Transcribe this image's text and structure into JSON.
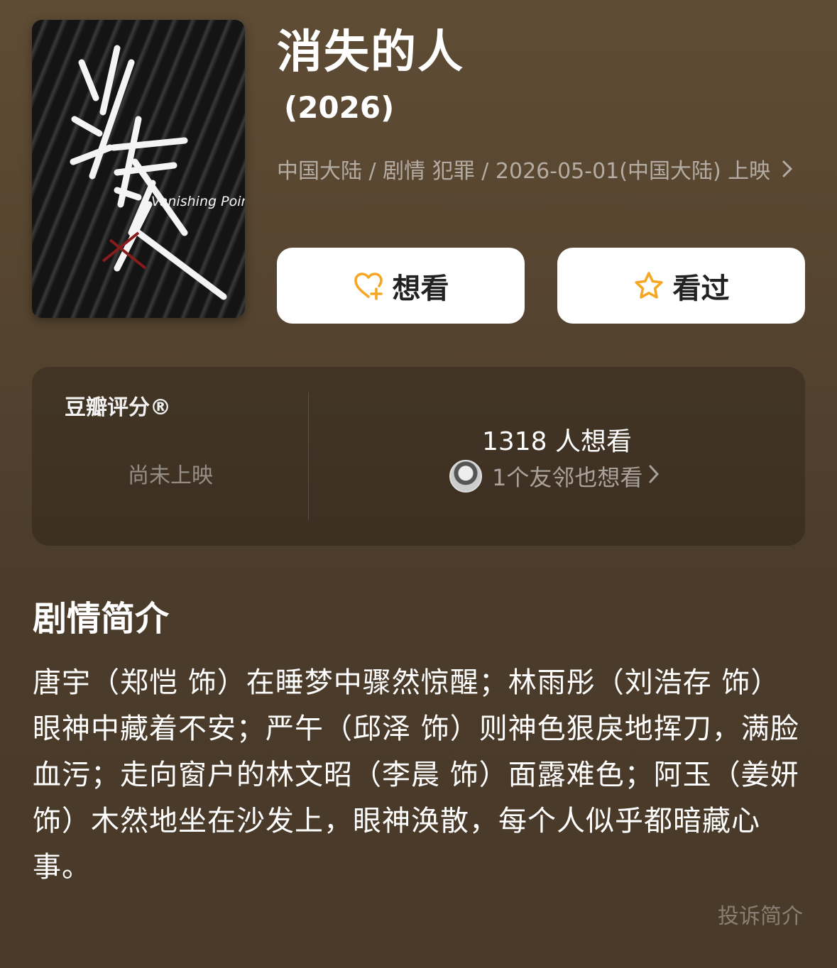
{
  "movie": {
    "title": "消失的人",
    "year": " (2026)",
    "meta_text": "中国大陆 / 剧情 犯罪 / 2026-05-01(中国大陆) 上映",
    "poster_title_cn": "消失的人",
    "poster_title_en": "Vanishing Point"
  },
  "actions": {
    "want_label": "想看",
    "seen_label": "看过",
    "accent_color": "#f5a623"
  },
  "rating": {
    "label": "豆瓣评分®",
    "status": "尚未上映",
    "want_count_text": "1318 人想看",
    "friends_text": "1个友邻也想看"
  },
  "synopsis": {
    "title": "剧情简介",
    "body": "唐宇（郑恺 饰）在睡梦中骤然惊醒；林雨彤（刘浩存 饰）眼神中藏着不安；严午（邱泽 饰）则神色狠戾地挥刀，满脸血污；走向窗户的林文昭（李晨 饰）面露难色；阿玉（姜妍 饰）木然地坐在沙发上，眼神涣散，每个人似乎都暗藏心事。",
    "report_label": "投诉简介"
  }
}
